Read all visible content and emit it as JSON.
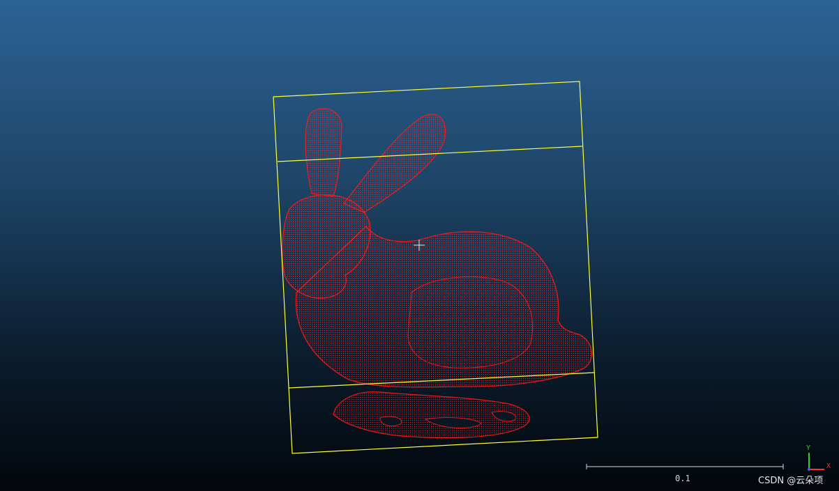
{
  "viewer": {
    "scale_bar_value": "0.1",
    "watermark": "CSDN @云朵项",
    "axes": {
      "y_label": "Y",
      "x_label": "X"
    }
  },
  "colors": {
    "point_cloud": "#e01818",
    "bounding_box": "#ffff33",
    "bg_top": "#2c6395",
    "bg_bottom": "#02060b",
    "axis_x": "#ff3030",
    "axis_y": "#30d030",
    "axis_z": "#4060ff"
  },
  "icons": [
    "crosshair-cursor-icon",
    "axes-triad-icon"
  ]
}
